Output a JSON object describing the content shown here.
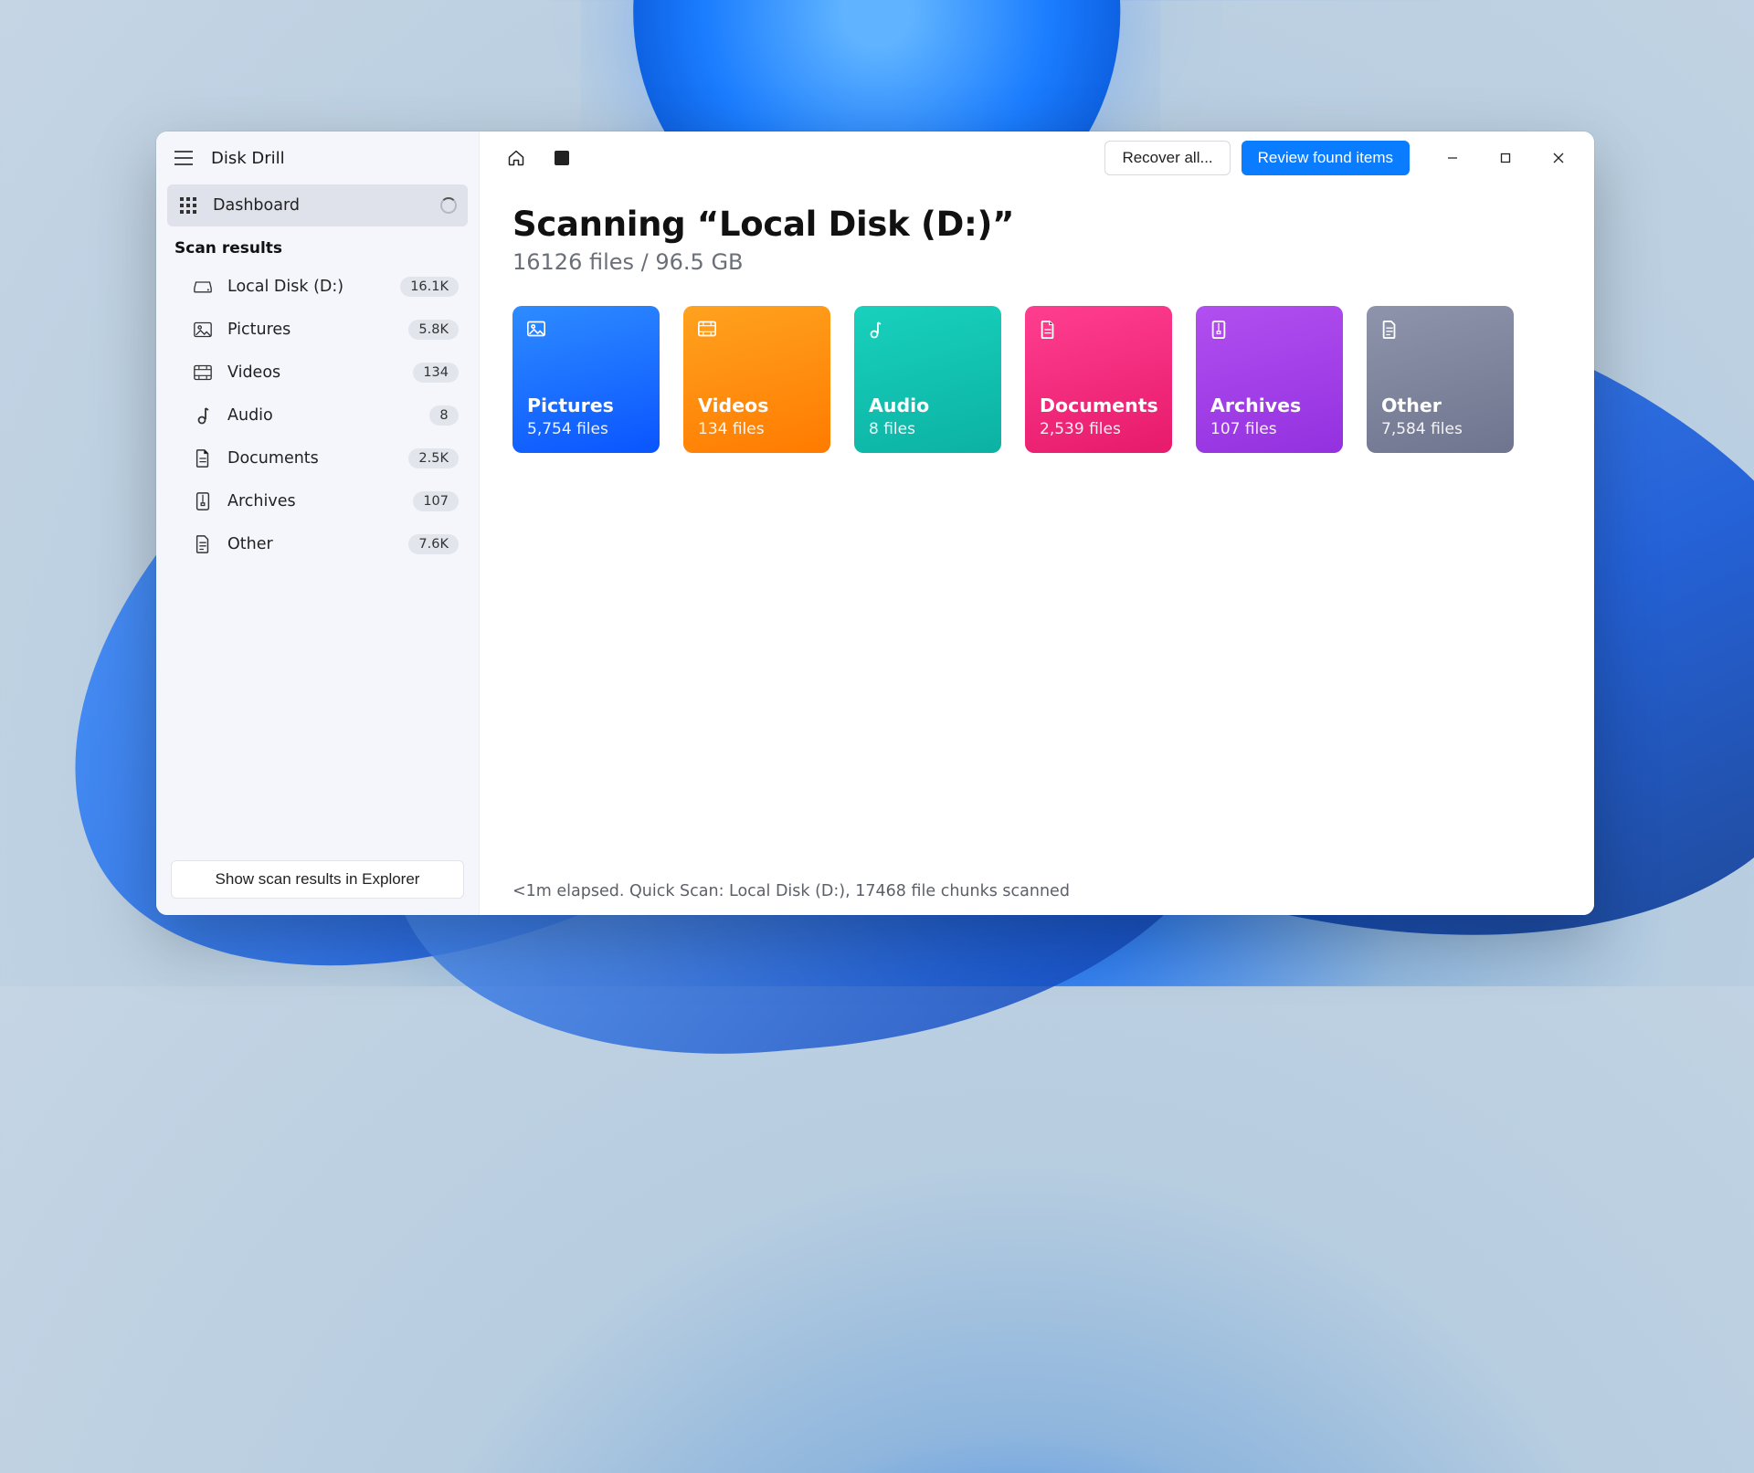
{
  "app_title": "Disk Drill",
  "nav": {
    "dashboard": "Dashboard"
  },
  "section_title": "Scan results",
  "scan_items": [
    {
      "icon": "drive",
      "label": "Local Disk (D:)",
      "badge": "16.1K"
    },
    {
      "icon": "picture",
      "label": "Pictures",
      "badge": "5.8K"
    },
    {
      "icon": "video",
      "label": "Videos",
      "badge": "134"
    },
    {
      "icon": "audio",
      "label": "Audio",
      "badge": "8"
    },
    {
      "icon": "document",
      "label": "Documents",
      "badge": "2.5K"
    },
    {
      "icon": "archive",
      "label": "Archives",
      "badge": "107"
    },
    {
      "icon": "other",
      "label": "Other",
      "badge": "7.6K"
    }
  ],
  "bottom_button": "Show scan results in Explorer",
  "toolbar": {
    "recover_all": "Recover all...",
    "review": "Review found items"
  },
  "heading": "Scanning “Local Disk (D:)”",
  "subheading": "16126 files / 96.5 GB",
  "cards": [
    {
      "title": "Pictures",
      "count": "5,754 files",
      "class": "c-blue",
      "icon": "picture"
    },
    {
      "title": "Videos",
      "count": "134 files",
      "class": "c-orange",
      "icon": "video"
    },
    {
      "title": "Audio",
      "count": "8 files",
      "class": "c-teal",
      "icon": "audio"
    },
    {
      "title": "Documents",
      "count": "2,539 files",
      "class": "c-pink",
      "icon": "document"
    },
    {
      "title": "Archives",
      "count": "107 files",
      "class": "c-purple",
      "icon": "archive"
    },
    {
      "title": "Other",
      "count": "7,584 files",
      "class": "c-grey",
      "icon": "other"
    }
  ],
  "status": "<1m elapsed. Quick Scan: Local Disk (D:), 17468 file chunks scanned"
}
